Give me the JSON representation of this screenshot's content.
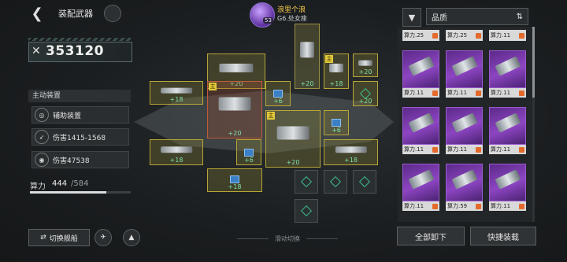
{
  "header": {
    "title": "装配武器"
  },
  "player": {
    "name": "浪里个浪",
    "level": "53",
    "subtitle": "G6.处女座"
  },
  "power": {
    "value": "353120"
  },
  "active_equipment": {
    "header": "主动装置",
    "items": [
      {
        "label": "辅助装置",
        "icon": "aux-device-icon"
      },
      {
        "label": "伤害1415-1568",
        "icon": "damage-range-icon"
      },
      {
        "label": "伤害47538",
        "icon": "damage-icon"
      }
    ]
  },
  "capacity": {
    "label": "算力",
    "used": "444",
    "total": "/584",
    "fraction": 0.76
  },
  "bottom_left": {
    "switch_ship": "切换舰船",
    "slide_hint": "滑动切换"
  },
  "slots": {
    "mark_label": "主",
    "bonuses": [
      "+20",
      "+18",
      "+6",
      "+20",
      "+18",
      "+20",
      "+20",
      "+6",
      "+20",
      "+18",
      "+6",
      "+20",
      "+18",
      "+18"
    ]
  },
  "filter": {
    "label": "品质"
  },
  "inventory": {
    "top_row": [
      "算力.25",
      "算力.25",
      "算力.11"
    ],
    "cards": [
      "算力.11",
      "算力.11",
      "算力.11",
      "算力.11",
      "算力.11",
      "算力.11",
      "算力.11",
      "算力.11",
      "算力.11",
      "算力.11",
      "算力.59",
      "算力.11"
    ]
  },
  "actions": {
    "unequip_all": "全部卸下",
    "quick_equip": "快捷装载"
  },
  "colors": {
    "accent_gold": "#e1c83b",
    "bonus_green": "#7fe3a8",
    "card_purple": "#8d45c2"
  }
}
